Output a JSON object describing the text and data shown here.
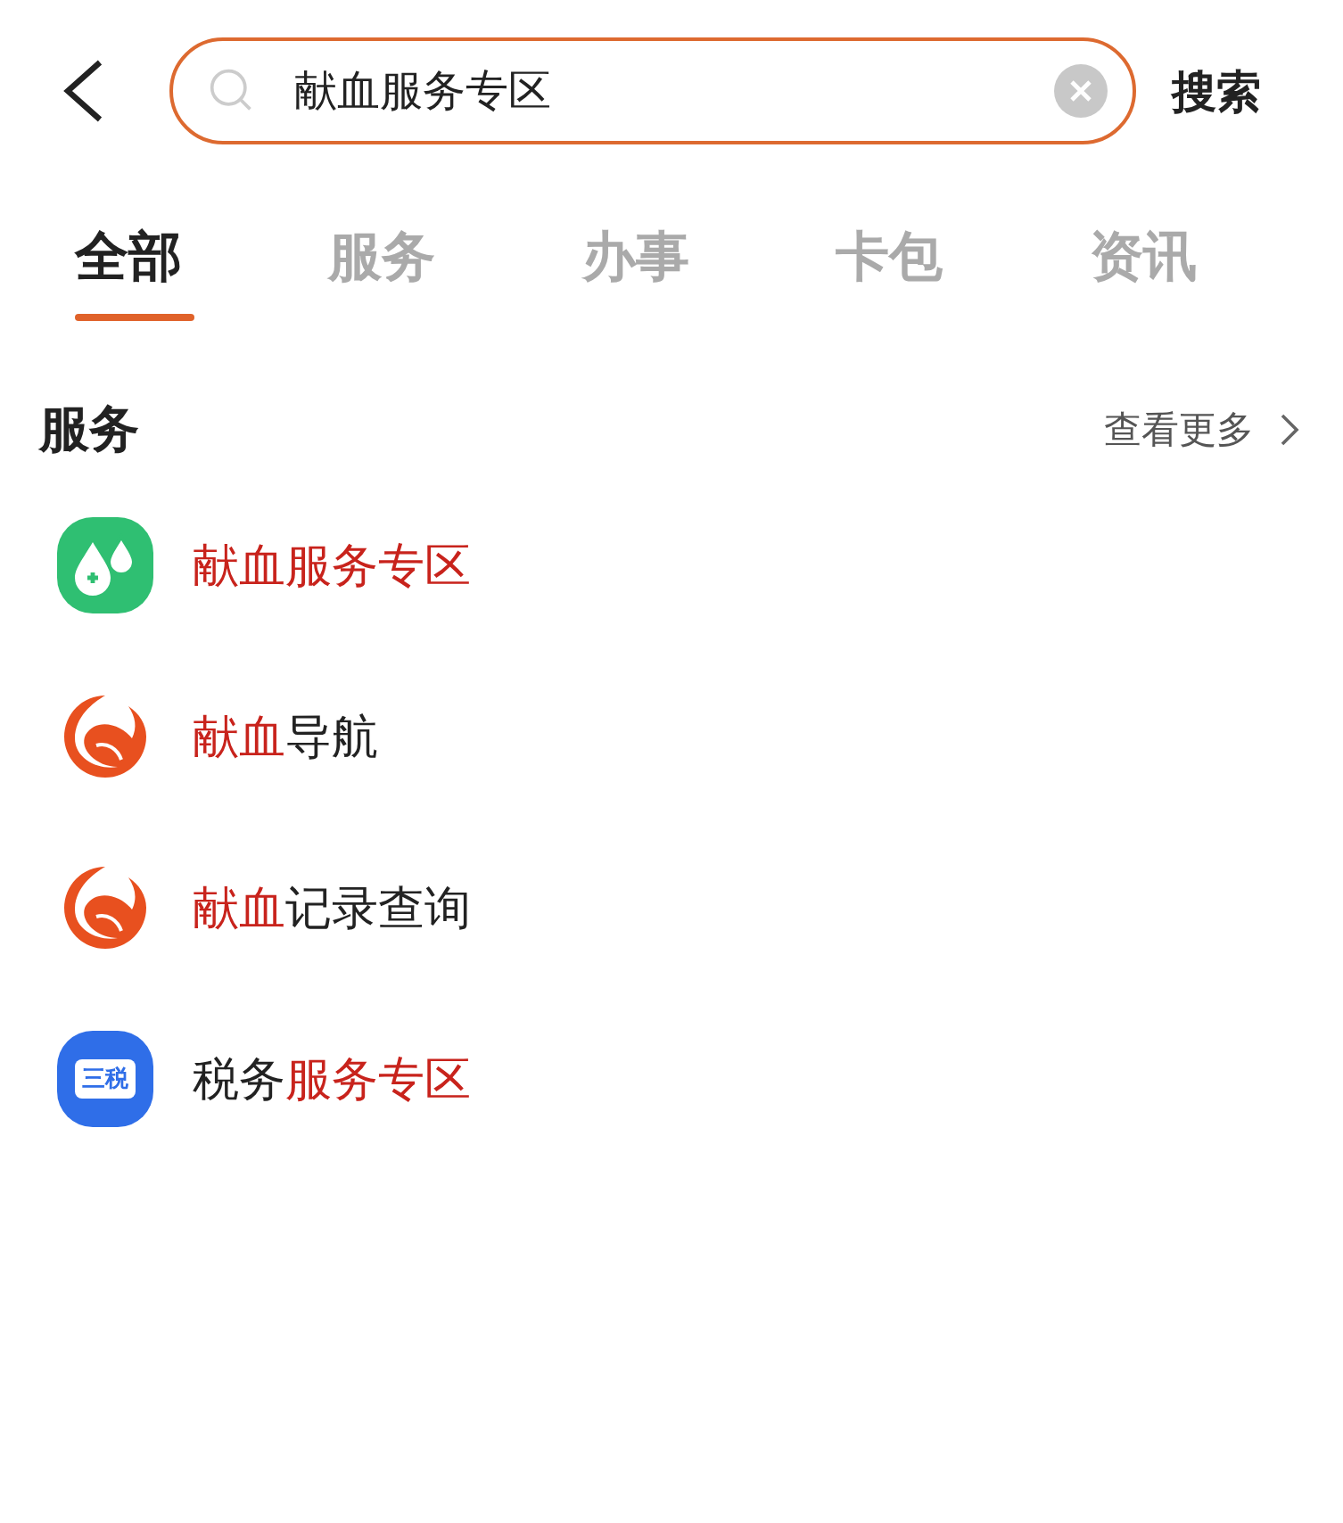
{
  "search": {
    "value": "献血服务专区",
    "action": "搜索"
  },
  "tabs": [
    {
      "label": "全部",
      "selected": true
    },
    {
      "label": "服务",
      "selected": false
    },
    {
      "label": "办事",
      "selected": false
    },
    {
      "label": "卡包",
      "selected": false
    },
    {
      "label": "资讯",
      "selected": false
    }
  ],
  "section": {
    "title": "服务",
    "more": "查看更多"
  },
  "results": [
    {
      "kind": "drops",
      "title": [
        {
          "text": "献血服务专区",
          "highlight": true
        }
      ]
    },
    {
      "kind": "swirl",
      "title": [
        {
          "text": "献血",
          "highlight": true
        },
        {
          "text": "导航",
          "highlight": false
        }
      ]
    },
    {
      "kind": "swirl",
      "title": [
        {
          "text": "献血",
          "highlight": true
        },
        {
          "text": "记录查询",
          "highlight": false
        }
      ]
    },
    {
      "kind": "tax",
      "icon_text": "三税",
      "title": [
        {
          "text": "税务",
          "highlight": false
        },
        {
          "text": "服务专区",
          "highlight": true
        }
      ]
    }
  ]
}
